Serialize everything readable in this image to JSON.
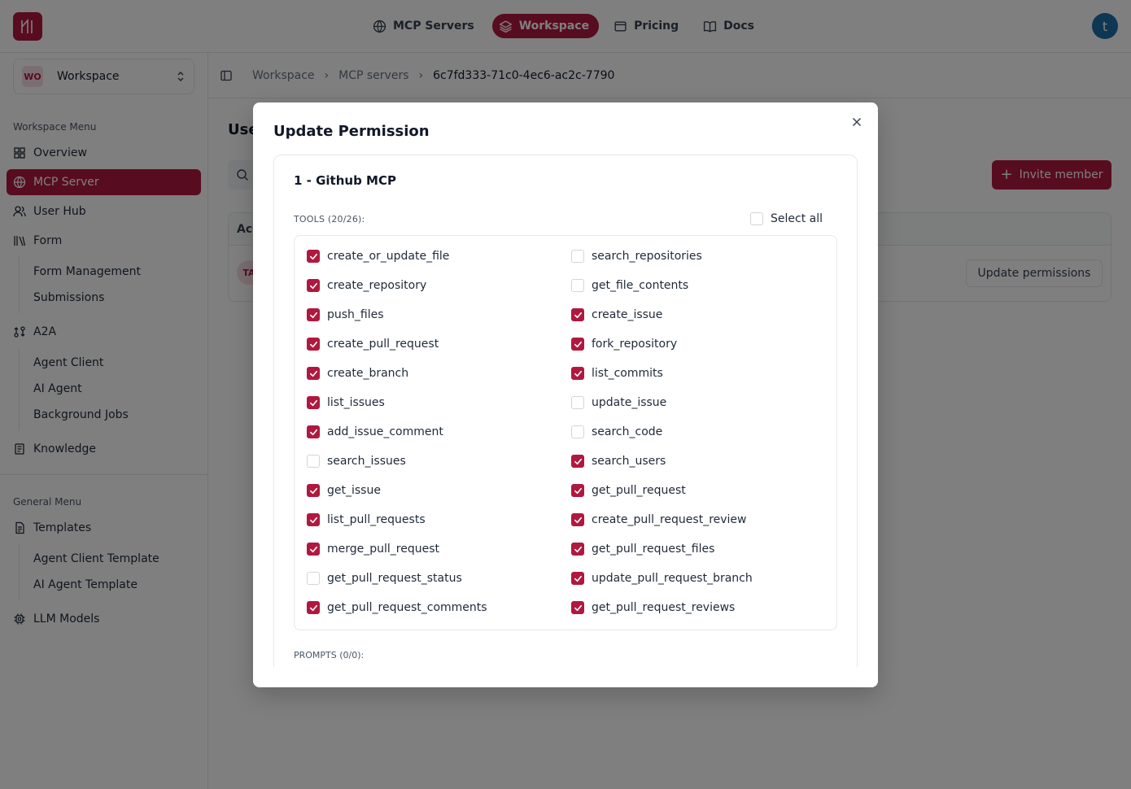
{
  "nav": {
    "items": [
      {
        "label": "MCP Servers",
        "icon": "globe-icon",
        "active": false
      },
      {
        "label": "Workspace",
        "icon": "layers-icon",
        "active": true
      },
      {
        "label": "Pricing",
        "icon": "wallet-icon",
        "active": false
      },
      {
        "label": "Docs",
        "icon": "book-open-icon",
        "active": false
      }
    ],
    "avatar_letter": "t"
  },
  "sidebar": {
    "workspace_badge": "WO",
    "workspace_name": "Workspace",
    "workspace_menu_title": "Workspace Menu",
    "general_menu_title": "General Menu",
    "items": {
      "overview": "Overview",
      "mcp_server": "MCP Server",
      "user_hub": "User Hub",
      "form": "Form",
      "form_management": "Form Management",
      "submissions": "Submissions",
      "a2a": "A2A",
      "agent_client": "Agent Client",
      "ai_agent": "AI Agent",
      "background_jobs": "Background Jobs",
      "knowledge": "Knowledge",
      "templates": "Templates",
      "agent_client_template": "Agent Client Template",
      "ai_agent_template": "AI Agent Template",
      "llm_models": "LLM Models"
    }
  },
  "breadcrumb": {
    "items": [
      "Workspace",
      "MCP servers",
      "6c7fd333-71c0-4ec6-ac2c-7790"
    ]
  },
  "main": {
    "title_partial": "Use",
    "invite_label": "Invite member",
    "table_header_partial": "Acc",
    "row_avatar": "TA",
    "update_button": "Update permissions"
  },
  "modal": {
    "title": "Update Permission",
    "server_title": "1 - Github MCP",
    "tools_label": "TOOLS (20/26):",
    "select_all_label": "Select all",
    "prompts_label": "PROMPTS (0/0):",
    "tools_left": [
      {
        "name": "create_or_update_file",
        "checked": true
      },
      {
        "name": "create_repository",
        "checked": true
      },
      {
        "name": "push_files",
        "checked": true
      },
      {
        "name": "create_pull_request",
        "checked": true
      },
      {
        "name": "create_branch",
        "checked": true
      },
      {
        "name": "list_issues",
        "checked": true
      },
      {
        "name": "add_issue_comment",
        "checked": true
      },
      {
        "name": "search_issues",
        "checked": false
      },
      {
        "name": "get_issue",
        "checked": true
      },
      {
        "name": "list_pull_requests",
        "checked": true
      },
      {
        "name": "merge_pull_request",
        "checked": true
      },
      {
        "name": "get_pull_request_status",
        "checked": false
      },
      {
        "name": "get_pull_request_comments",
        "checked": true
      }
    ],
    "tools_right": [
      {
        "name": "search_repositories",
        "checked": false
      },
      {
        "name": "get_file_contents",
        "checked": false
      },
      {
        "name": "create_issue",
        "checked": true
      },
      {
        "name": "fork_repository",
        "checked": true
      },
      {
        "name": "list_commits",
        "checked": true
      },
      {
        "name": "update_issue",
        "checked": false
      },
      {
        "name": "search_code",
        "checked": false
      },
      {
        "name": "search_users",
        "checked": true
      },
      {
        "name": "get_pull_request",
        "checked": true
      },
      {
        "name": "create_pull_request_review",
        "checked": true
      },
      {
        "name": "get_pull_request_files",
        "checked": true
      },
      {
        "name": "update_pull_request_branch",
        "checked": true
      },
      {
        "name": "get_pull_request_reviews",
        "checked": true
      }
    ]
  },
  "colors": {
    "accent": "#b0183f",
    "avatar": "#1d6fa8"
  }
}
